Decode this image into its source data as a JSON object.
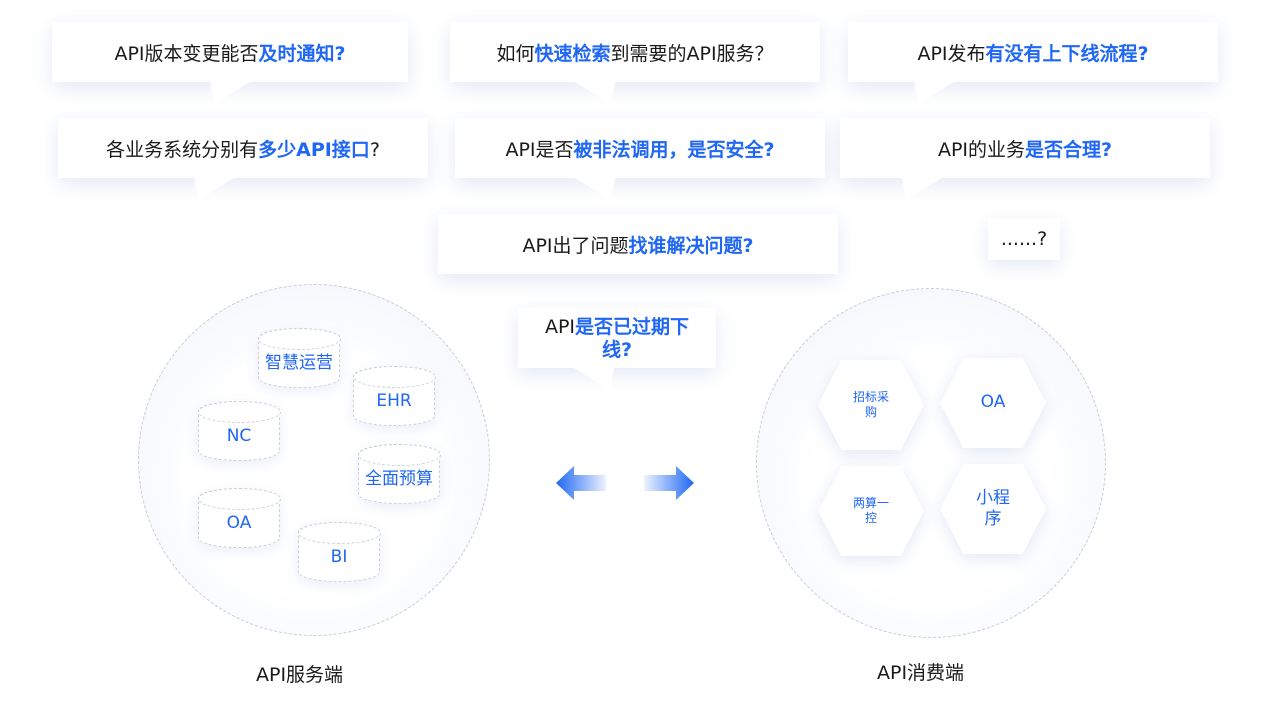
{
  "questions": {
    "q1": {
      "pre": "API版本变更能否",
      "hl": "及时通知?",
      "post": ""
    },
    "q2": {
      "pre": "如何",
      "hl": "快速检索",
      "post": "到需要的API服务？"
    },
    "q3": {
      "pre": "API发布",
      "hl": "有没有上下线流程?",
      "post": ""
    },
    "q4": {
      "pre": "各业务系统分别有",
      "hl": "多少API接口",
      "post": "?"
    },
    "q5": {
      "pre": "API是否",
      "hl": "被非法调用，是否安全?",
      "post": ""
    },
    "q6": {
      "pre": "API的业务",
      "hl": "是否合理?",
      "post": ""
    },
    "q7": {
      "pre": "API出了问题",
      "hl": "找谁解决问题?",
      "post": ""
    },
    "q8": {
      "text": "......?"
    },
    "q9": {
      "pre": "API",
      "hl_line1": "是否已过期下",
      "hl_line2": "线?"
    }
  },
  "server": {
    "caption": "API服务端",
    "databases": [
      "智慧运营",
      "EHR",
      "NC",
      "全面预算",
      "OA",
      "BI"
    ]
  },
  "consumer": {
    "caption": "API消费端",
    "apps": [
      "招标采购",
      "OA",
      "两算一控",
      "小程序"
    ]
  },
  "colors": {
    "accent": "#1f67f4",
    "text": "#1a1a1a"
  },
  "icons": [
    "arrow-left-icon",
    "arrow-right-icon"
  ]
}
